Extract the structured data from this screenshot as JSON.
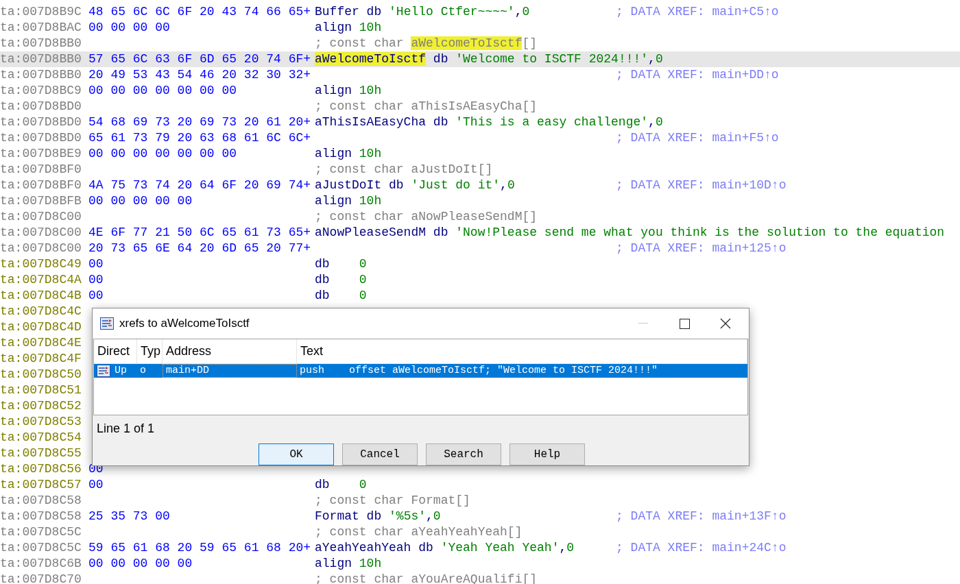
{
  "listing": {
    "rows": [
      {
        "address": "ta:007D8B9C",
        "color": "#808080",
        "selected": false,
        "bytes": "48 65 6C 6C 6F 20 43 74 66 65+",
        "code": [
          {
            "kind": "code",
            "text": "Buffer db "
          },
          {
            "kind": "value",
            "text": "'Hello Ctfer~~~~'"
          },
          {
            "kind": "code",
            "text": ","
          },
          {
            "kind": "value",
            "text": "0"
          }
        ],
        "comment": "; DATA XREF: main+C5↑o"
      },
      {
        "address": "ta:007D8BAC",
        "color": "#808080",
        "selected": false,
        "bytes": "00 00 00 00",
        "code": [
          {
            "kind": "code",
            "text": "align "
          },
          {
            "kind": "value",
            "text": "10h"
          }
        ]
      },
      {
        "address": "ta:007D8BB0",
        "color": "#808080",
        "selected": false,
        "code": [
          {
            "kind": "comment",
            "text": "; const char "
          },
          {
            "kind": "comment",
            "text": "aWelcomeToIsctf",
            "highlighted": true
          },
          {
            "kind": "comment",
            "text": "[]"
          }
        ]
      },
      {
        "address": "ta:007D8BB0",
        "color": "#808080",
        "selected": true,
        "bytes": "57 65 6C 63 6F 6D 65 20 74 6F+",
        "code": [
          {
            "kind": "code",
            "text": "aWelcomeToIsctf",
            "highlighted": true
          },
          {
            "kind": "code",
            "text": " db "
          },
          {
            "kind": "value",
            "text": "'Welcome to ISCTF 2024!!!'"
          },
          {
            "kind": "code",
            "text": ","
          },
          {
            "kind": "value",
            "text": "0"
          }
        ]
      },
      {
        "address": "ta:007D8BB0",
        "color": "#808080",
        "selected": false,
        "bytes": "20 49 53 43 54 46 20 32 30 32+",
        "comment": "; DATA XREF: main+DD↑o"
      },
      {
        "address": "ta:007D8BC9",
        "color": "#808080",
        "selected": false,
        "bytes": "00 00 00 00 00 00 00",
        "code": [
          {
            "kind": "code",
            "text": "align "
          },
          {
            "kind": "value",
            "text": "10h"
          }
        ]
      },
      {
        "address": "ta:007D8BD0",
        "color": "#808080",
        "selected": false,
        "code": [
          {
            "kind": "comment",
            "text": "; const char aThisIsAEasyCha[]"
          }
        ]
      },
      {
        "address": "ta:007D8BD0",
        "color": "#808080",
        "selected": false,
        "bytes": "54 68 69 73 20 69 73 20 61 20+",
        "code": [
          {
            "kind": "code",
            "text": "aThisIsAEasyCha db "
          },
          {
            "kind": "value",
            "text": "'This is a easy challenge'"
          },
          {
            "kind": "code",
            "text": ","
          },
          {
            "kind": "value",
            "text": "0"
          }
        ]
      },
      {
        "address": "ta:007D8BD0",
        "color": "#808080",
        "selected": false,
        "bytes": "65 61 73 79 20 63 68 61 6C 6C+",
        "comment": "; DATA XREF: main+F5↑o"
      },
      {
        "address": "ta:007D8BE9",
        "color": "#808080",
        "selected": false,
        "bytes": "00 00 00 00 00 00 00",
        "code": [
          {
            "kind": "code",
            "text": "align "
          },
          {
            "kind": "value",
            "text": "10h"
          }
        ]
      },
      {
        "address": "ta:007D8BF0",
        "color": "#808080",
        "selected": false,
        "code": [
          {
            "kind": "comment",
            "text": "; const char aJustDoIt[]"
          }
        ]
      },
      {
        "address": "ta:007D8BF0",
        "color": "#808080",
        "selected": false,
        "bytes": "4A 75 73 74 20 64 6F 20 69 74+",
        "code": [
          {
            "kind": "code",
            "text": "aJustDoIt db "
          },
          {
            "kind": "value",
            "text": "'Just do it'"
          },
          {
            "kind": "code",
            "text": ","
          },
          {
            "kind": "value",
            "text": "0"
          }
        ],
        "comment": "; DATA XREF: main+10D↑o"
      },
      {
        "address": "ta:007D8BFB",
        "color": "#808080",
        "selected": false,
        "bytes": "00 00 00 00 00",
        "code": [
          {
            "kind": "code",
            "text": "align "
          },
          {
            "kind": "value",
            "text": "10h"
          }
        ]
      },
      {
        "address": "ta:007D8C00",
        "color": "#808080",
        "selected": false,
        "code": [
          {
            "kind": "comment",
            "text": "; const char aNowPleaseSendM[]"
          }
        ]
      },
      {
        "address": "ta:007D8C00",
        "color": "#808080",
        "selected": false,
        "bytes": "4E 6F 77 21 50 6C 65 61 73 65+",
        "code": [
          {
            "kind": "code",
            "text": "aNowPleaseSendM db "
          },
          {
            "kind": "value",
            "text": "'Now!Please send me what you think is the solution to the equation"
          }
        ]
      },
      {
        "address": "ta:007D8C00",
        "color": "#808080",
        "selected": false,
        "bytes": "20 73 65 6E 64 20 6D 65 20 77+",
        "comment": "; DATA XREF: main+125↑o"
      },
      {
        "address": "ta:007D8C49",
        "color": "#808000",
        "selected": false,
        "bytes": "00",
        "code": [
          {
            "kind": "code",
            "text": "db    "
          },
          {
            "kind": "value",
            "text": "0"
          }
        ]
      },
      {
        "address": "ta:007D8C4A",
        "color": "#808000",
        "selected": false,
        "bytes": "00",
        "code": [
          {
            "kind": "code",
            "text": "db    "
          },
          {
            "kind": "value",
            "text": "0"
          }
        ]
      },
      {
        "address": "ta:007D8C4B",
        "color": "#808000",
        "selected": false,
        "bytes": "00",
        "code": [
          {
            "kind": "code",
            "text": "db    "
          },
          {
            "kind": "value",
            "text": "0"
          }
        ]
      },
      {
        "address": "ta:007D8C4C",
        "color": "#808000",
        "selected": false
      },
      {
        "address": "ta:007D8C4D",
        "color": "#808000",
        "selected": false
      },
      {
        "address": "ta:007D8C4E",
        "color": "#808000",
        "selected": false
      },
      {
        "address": "ta:007D8C4F",
        "color": "#808000",
        "selected": false
      },
      {
        "address": "ta:007D8C50",
        "color": "#808000",
        "selected": false
      },
      {
        "address": "ta:007D8C51",
        "color": "#808000",
        "selected": false
      },
      {
        "address": "ta:007D8C52",
        "color": "#808000",
        "selected": false
      },
      {
        "address": "ta:007D8C53",
        "color": "#808000",
        "selected": false
      },
      {
        "address": "ta:007D8C54",
        "color": "#808000",
        "selected": false
      },
      {
        "address": "ta:007D8C55",
        "color": "#808000",
        "selected": false
      },
      {
        "address": "ta:007D8C56",
        "color": "#808000",
        "selected": false,
        "bytes": "00"
      },
      {
        "address": "ta:007D8C57",
        "color": "#808000",
        "selected": false,
        "bytes": "00",
        "code": [
          {
            "kind": "code",
            "text": "db    "
          },
          {
            "kind": "value",
            "text": "0"
          }
        ]
      },
      {
        "address": "ta:007D8C58",
        "color": "#808080",
        "selected": false,
        "code": [
          {
            "kind": "comment",
            "text": "; const char Format[]"
          }
        ]
      },
      {
        "address": "ta:007D8C58",
        "color": "#808080",
        "selected": false,
        "bytes": "25 35 73 00",
        "code": [
          {
            "kind": "code",
            "text": "Format db "
          },
          {
            "kind": "value",
            "text": "'%5s'"
          },
          {
            "kind": "code",
            "text": ","
          },
          {
            "kind": "value",
            "text": "0"
          }
        ],
        "comment": "; DATA XREF: main+13F↑o"
      },
      {
        "address": "ta:007D8C5C",
        "color": "#808080",
        "selected": false,
        "code": [
          {
            "kind": "comment",
            "text": "; const char aYeahYeahYeah[]"
          }
        ]
      },
      {
        "address": "ta:007D8C5C",
        "color": "#808080",
        "selected": false,
        "bytes": "59 65 61 68 20 59 65 61 68 20+",
        "code": [
          {
            "kind": "code",
            "text": "aYeahYeahYeah db "
          },
          {
            "kind": "value",
            "text": "'Yeah Yeah Yeah'"
          },
          {
            "kind": "code",
            "text": ","
          },
          {
            "kind": "value",
            "text": "0"
          }
        ],
        "comment": "; DATA XREF: main+24C↑o"
      },
      {
        "address": "ta:007D8C6B",
        "color": "#808080",
        "selected": false,
        "bytes": "00 00 00 00 00",
        "code": [
          {
            "kind": "code",
            "text": "align "
          },
          {
            "kind": "value",
            "text": "10h"
          }
        ]
      },
      {
        "address": "ta:007D8C70",
        "color": "#808080",
        "selected": false,
        "code": [
          {
            "kind": "comment",
            "text": "; const char aYouAreAQualifi[]"
          }
        ]
      }
    ]
  },
  "dialog": {
    "title": "xrefs to aWelcomeToIsctf",
    "columns": [
      "Direct",
      "Typ",
      "Address",
      "Text"
    ],
    "rows": [
      {
        "cells": [
          "Up",
          "o",
          "main+DD",
          "push    offset aWelcomeToIsctf; \"Welcome to ISCTF 2024!!!\""
        ],
        "selected": true
      }
    ],
    "status": "Line 1 of 1",
    "buttons": [
      {
        "label": "OK",
        "focused": true
      },
      {
        "label": "Cancel",
        "focused": false
      },
      {
        "label": "Search",
        "focused": false
      },
      {
        "label": "Help",
        "focused": false
      }
    ]
  }
}
